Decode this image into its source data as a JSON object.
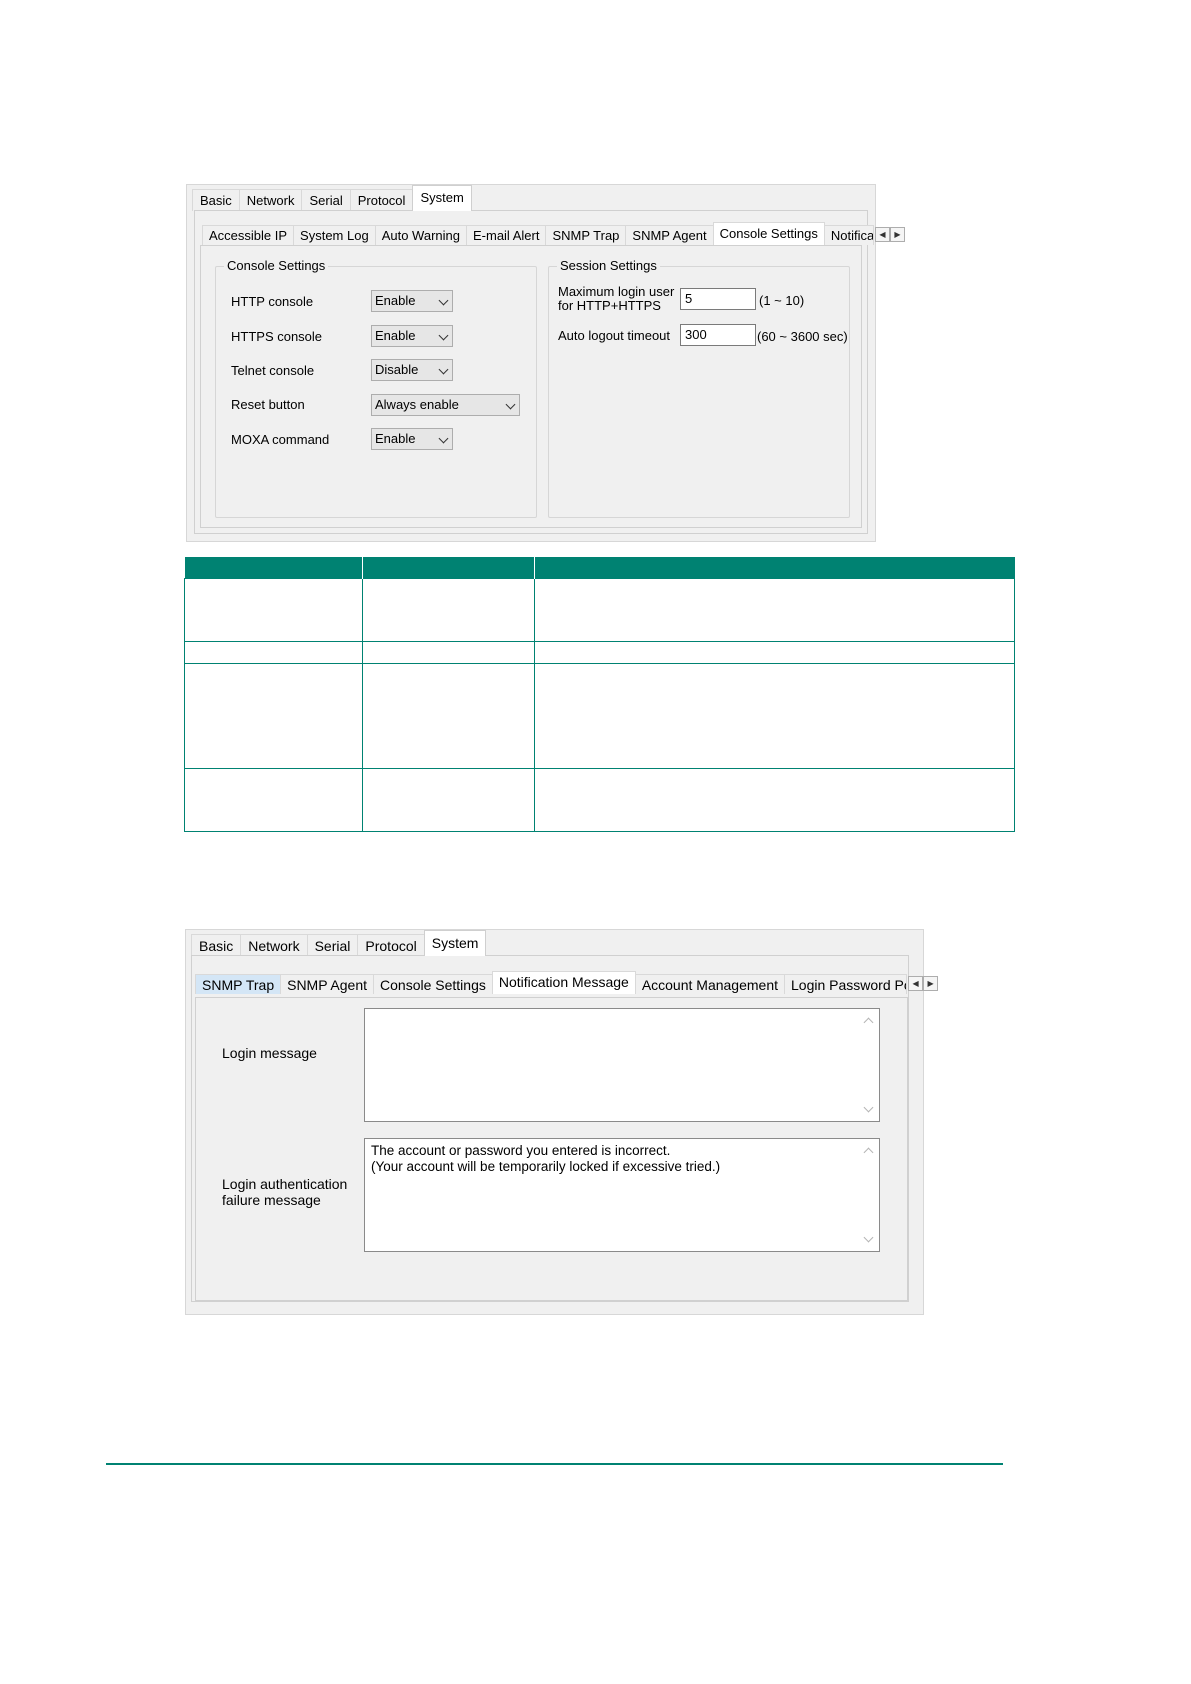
{
  "figure1": {
    "top_tabs": [
      "Basic",
      "Network",
      "Serial",
      "Protocol",
      "System"
    ],
    "active_top_tab": "System",
    "sub_tabs": [
      "Accessible IP",
      "System Log",
      "Auto Warning",
      "E-mail Alert",
      "SNMP Trap",
      "SNMP Agent",
      "Console Settings",
      "Notifica"
    ],
    "active_sub_tab": "Console Settings",
    "console_group": {
      "title": "Console Settings",
      "rows": [
        {
          "label": "HTTP console",
          "value": "Enable"
        },
        {
          "label": "HTTPS console",
          "value": "Enable"
        },
        {
          "label": "Telnet console",
          "value": "Disable"
        },
        {
          "label": "Reset button",
          "value": "Always enable"
        },
        {
          "label": "MOXA command",
          "value": "Enable"
        }
      ]
    },
    "session_group": {
      "title": "Session Settings",
      "max_login_label": "Maximum login user\nfor HTTP+HTTPS",
      "max_login_value": "5",
      "max_login_range": "(1 ~ 10)",
      "auto_logout_label": "Auto logout timeout",
      "auto_logout_value": "300",
      "auto_logout_range": "(60 ~ 3600 sec)"
    }
  },
  "table": {
    "rows": 4
  },
  "figure2": {
    "top_tabs": [
      "Basic",
      "Network",
      "Serial",
      "Protocol",
      "System"
    ],
    "active_top_tab": "System",
    "sub_tabs": [
      "SNMP Trap",
      "SNMP Agent",
      "Console Settings",
      "Notification Message",
      "Account Management",
      "Login Password Polic"
    ],
    "active_sub_tab": "Notification Message",
    "login_message_label": "Login message",
    "login_message_value": "",
    "failure_label": "Login authentication\nfailure message",
    "failure_value": "The account or password you entered is incorrect.\n(Your account will be temporarily locked if excessive tried.)"
  },
  "colors": {
    "accent": "#008272"
  }
}
